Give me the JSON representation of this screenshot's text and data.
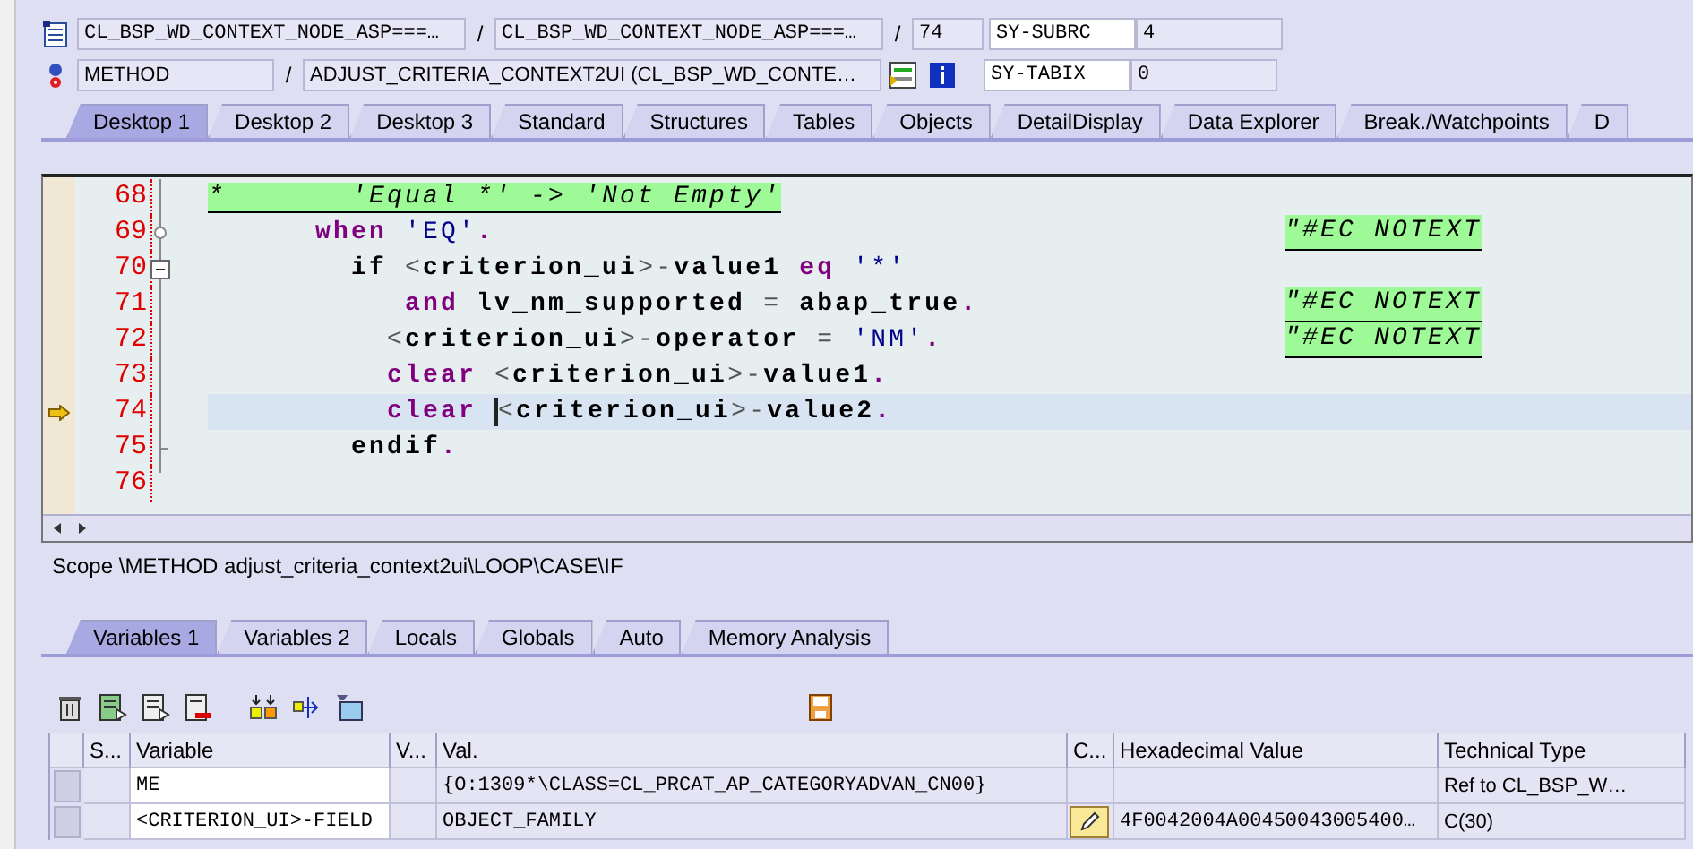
{
  "header": {
    "rows": [
      {
        "fields": [
          {
            "value": "CL_BSP_WD_CONTEXT_NODE_ASP===…"
          },
          {
            "sep": "/"
          },
          {
            "value": "CL_BSP_WD_CONTEXT_NODE_ASP===…"
          },
          {
            "sep": "/"
          },
          {
            "value": "74"
          }
        ],
        "sysvar": {
          "name": "SY-SUBRC",
          "value": "4"
        }
      },
      {
        "fields": [
          {
            "value": "METHOD"
          },
          {
            "sep": "/"
          },
          {
            "value": "ADJUST_CRITERIA_CONTEXT2UI (CL_BSP_WD_CONTE…"
          }
        ],
        "sysvar": {
          "name": "SY-TABIX",
          "value": "0"
        }
      }
    ]
  },
  "desktop_tabs": [
    {
      "label": "Desktop 1",
      "selected": true
    },
    {
      "label": "Desktop 2",
      "selected": false
    },
    {
      "label": "Desktop 3",
      "selected": false
    },
    {
      "label": "Standard",
      "selected": false
    },
    {
      "label": "Structures",
      "selected": false
    },
    {
      "label": "Tables",
      "selected": false
    },
    {
      "label": "Objects",
      "selected": false
    },
    {
      "label": "DetailDisplay",
      "selected": false
    },
    {
      "label": "Data Explorer",
      "selected": false
    },
    {
      "label": "Break./Watchpoints",
      "selected": false
    },
    {
      "label": "D",
      "selected": false
    }
  ],
  "editor": {
    "lines": [
      {
        "number": "68",
        "current": false,
        "tokens": [
          {
            "kind": "comment",
            "text": "*       'Equal *' -> 'Not Empty'"
          }
        ]
      },
      {
        "number": "69",
        "current": false,
        "tokens": [
          {
            "kind": "keyword",
            "text": "      when"
          },
          {
            "kind": "string",
            "text": " 'EQ'"
          },
          {
            "kind": "punct",
            "text": "."
          }
        ],
        "note": "\"#EC NOTEXT"
      },
      {
        "number": "70",
        "current": false,
        "tokens": [
          {
            "kind": "ident",
            "text": "        if "
          },
          {
            "kind": "op",
            "text": "<"
          },
          {
            "kind": "ident",
            "text": "criterion_ui"
          },
          {
            "kind": "op",
            "text": ">-"
          },
          {
            "kind": "ident",
            "text": "value1"
          },
          {
            "kind": "keyword",
            "text": " eq"
          },
          {
            "kind": "string",
            "text": " '*'"
          }
        ]
      },
      {
        "number": "71",
        "current": false,
        "tokens": [
          {
            "kind": "keyword",
            "text": "           and"
          },
          {
            "kind": "ident",
            "text": " lv_nm_supported "
          },
          {
            "kind": "op",
            "text": "="
          },
          {
            "kind": "ident",
            "text": " abap_true"
          },
          {
            "kind": "punct",
            "text": "."
          }
        ],
        "note": "\"#EC NOTEXT"
      },
      {
        "number": "72",
        "current": false,
        "tokens": [
          {
            "kind": "op",
            "text": "          <"
          },
          {
            "kind": "ident",
            "text": "criterion_ui"
          },
          {
            "kind": "op",
            "text": ">-"
          },
          {
            "kind": "ident",
            "text": "operator "
          },
          {
            "kind": "op",
            "text": "="
          },
          {
            "kind": "string",
            "text": " 'NM'"
          },
          {
            "kind": "punct",
            "text": "."
          }
        ],
        "note": "\"#EC NOTEXT"
      },
      {
        "number": "73",
        "current": false,
        "tokens": [
          {
            "kind": "keyword",
            "text": "          clear"
          },
          {
            "kind": "op",
            "text": " <"
          },
          {
            "kind": "ident",
            "text": "criterion_ui"
          },
          {
            "kind": "op",
            "text": ">-"
          },
          {
            "kind": "ident",
            "text": "value1"
          },
          {
            "kind": "punct",
            "text": "."
          }
        ]
      },
      {
        "number": "74",
        "current": true,
        "tokens": [
          {
            "kind": "keyword",
            "text": "          clear "
          },
          {
            "kind": "op",
            "text": "<",
            "cursor": true
          },
          {
            "kind": "ident",
            "text": "criterion_ui"
          },
          {
            "kind": "op",
            "text": ">-"
          },
          {
            "kind": "ident",
            "text": "value2"
          },
          {
            "kind": "punct",
            "text": "."
          }
        ]
      },
      {
        "number": "75",
        "current": false,
        "tokens": [
          {
            "kind": "ident",
            "text": "        endif"
          },
          {
            "kind": "punct",
            "text": "."
          }
        ]
      },
      {
        "number": "76",
        "current": false
      }
    ]
  },
  "scope": "Scope \\METHOD adjust_criteria_context2ui\\LOOP\\CASE\\IF",
  "variable_tabs": [
    {
      "label": "Variables 1",
      "selected": true
    },
    {
      "label": "Variables 2",
      "selected": false
    },
    {
      "label": "Locals",
      "selected": false
    },
    {
      "label": "Globals",
      "selected": false
    },
    {
      "label": "Auto",
      "selected": false
    },
    {
      "label": "Memory Analysis",
      "selected": false
    }
  ],
  "table": {
    "columns": [
      "S...",
      "Variable",
      "V...",
      "Val.",
      "C...",
      "Hexadecimal Value",
      "Technical Type"
    ],
    "rows": [
      {
        "variable": "ME",
        "value": "{O:1309*\\CLASS=CL_PRCAT_AP_CATEGORYADVAN_CN00}",
        "editable": false,
        "type": "Ref to CL_BSP_W…"
      },
      {
        "variable": "<CRITERION_UI>-FIELD",
        "value": "OBJECT_FAMILY",
        "editable": true,
        "hex": "4F0042004A00450043005400…",
        "type": "C(30)"
      }
    ]
  }
}
